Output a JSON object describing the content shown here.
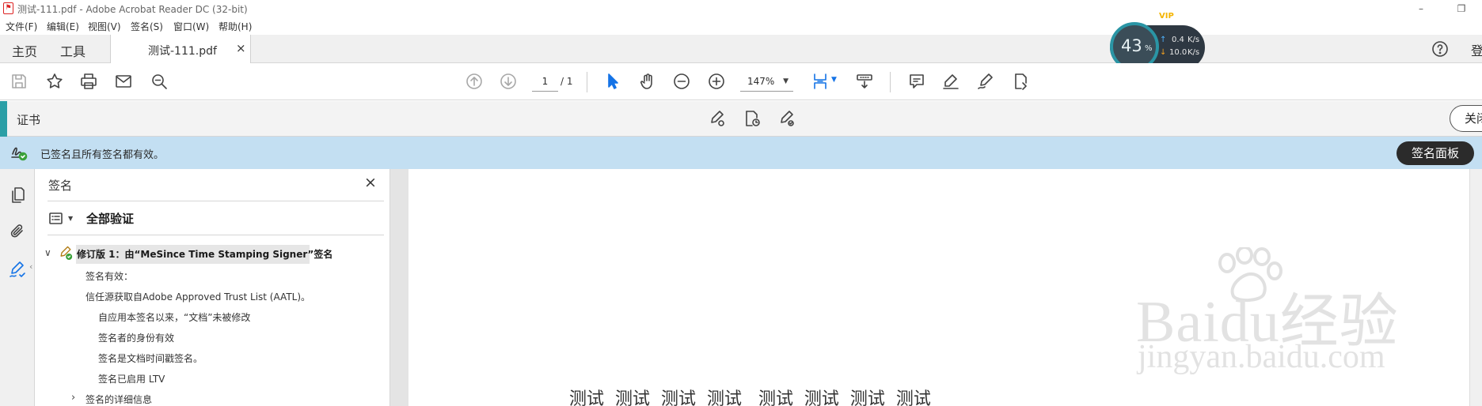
{
  "window": {
    "title": "测试-111.pdf - Adobe Acrobat Reader DC (32-bit)",
    "minimize": "–",
    "restore": "❐"
  },
  "menu": [
    "文件(F)",
    "编辑(E)",
    "视图(V)",
    "签名(S)",
    "窗口(W)",
    "帮助(H)"
  ],
  "nav": {
    "home": "主页",
    "tools": "工具",
    "doc_tab": "测试-111.pdf",
    "doc_tab_close": "×",
    "sign_in": "登"
  },
  "toolbar": {
    "page_current": "1",
    "page_total": "/ 1",
    "zoom": "147%"
  },
  "net_widget": {
    "percent": "43",
    "percent_sign": "%",
    "upload": "0.4",
    "download": "10.0",
    "unit": "K/s",
    "badge": "VIP"
  },
  "cert_bar": {
    "title": "证书",
    "close": "关闭"
  },
  "banner": {
    "message": "已签名且所有签名都有效。",
    "button": "签名面板"
  },
  "panel": {
    "title": "签名",
    "close": "×",
    "verify_all": "全部验证",
    "revision": "修订版 1：由“MeSince Time Stamping Signer”签名",
    "details": [
      "签名有效：",
      "信任源获取自Adobe Approved Trust List (AATL)。",
      "自应用本签名以来，“文档”未被修改",
      "签名者的身份有效",
      "签名是文档时间戳签名。",
      "签名已启用 LTV",
      "签名的详细信息"
    ]
  },
  "document": {
    "text": "测试  测试  测试  测试   测试  测试  测试  测试"
  },
  "watermark": {
    "line1": "Baidu经验",
    "line2": "jingyan.baidu.com"
  },
  "colors": {
    "accent": "#2b9fa6",
    "banner": "#c3dff2",
    "selection_blue": "#1473e6"
  }
}
